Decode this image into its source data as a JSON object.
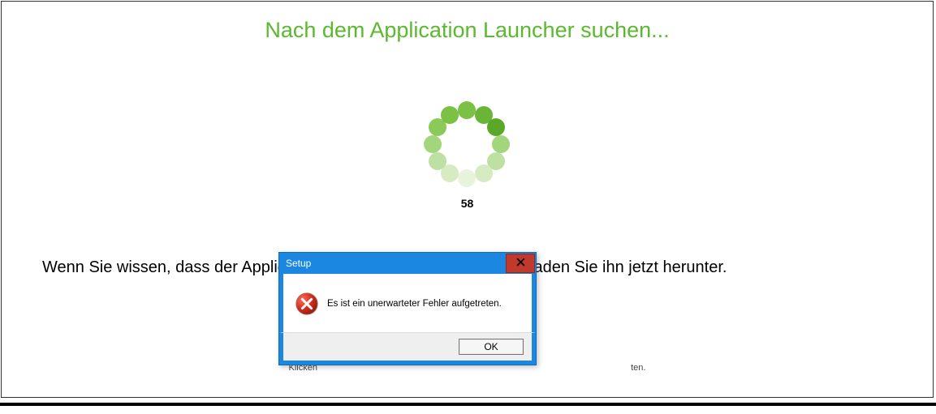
{
  "page": {
    "heading": "Nach dem Application Launcher suchen...",
    "counter": "58",
    "body_text": "Wenn Sie wissen, dass der Application Launcher nicht installiert ist, laden Sie ihn jetzt herunter.",
    "small_text_left": "Klicken",
    "small_text_right": "ten."
  },
  "spinner": {
    "dot_colors": [
      "#7bc143",
      "#6bb536",
      "#5aa82a",
      "#a3d57c",
      "#bfe0a3",
      "#d6ebc2",
      "#e8f3dc",
      "#d6ebc2",
      "#bfe0a3",
      "#a3d57c",
      "#8bca59",
      "#7bc143"
    ]
  },
  "dialog": {
    "title": "Setup",
    "message": "Es ist ein unerwarteter Fehler aufgetreten.",
    "ok_label": "OK"
  }
}
